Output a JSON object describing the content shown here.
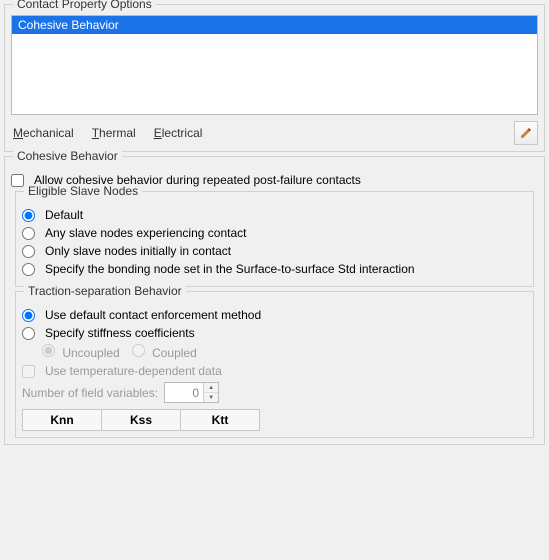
{
  "contact_property_options": {
    "legend": "Contact Property Options",
    "items": [
      "Cohesive Behavior"
    ],
    "selected_index": 0,
    "tabs": {
      "mechanical": "Mechanical",
      "thermal": "Thermal",
      "electrical": "Electrical"
    },
    "edit_tooltip": "Edit"
  },
  "cohesive": {
    "legend": "Cohesive Behavior",
    "allow_repeat": {
      "checked": false,
      "label": "Allow cohesive behavior during repeated post-failure contacts"
    },
    "eligible_slave_nodes": {
      "legend": "Eligible Slave Nodes",
      "selected": "default",
      "options": {
        "default": "Default",
        "any": "Any slave nodes experiencing contact",
        "only": "Only slave nodes initially in contact",
        "specify": "Specify the bonding node set in the Surface-to-surface Std interaction"
      }
    },
    "traction": {
      "legend": "Traction-separation Behavior",
      "selected": "default",
      "options": {
        "default": "Use default contact enforcement method",
        "specify": "Specify stiffness coefficients"
      },
      "coupling": {
        "selected": "uncoupled",
        "uncoupled": "Uncoupled",
        "coupled": "Coupled"
      },
      "use_temp_dependent": {
        "checked": false,
        "label": "Use temperature-dependent data"
      },
      "num_field_vars": {
        "label": "Number of field variables:",
        "value": 0
      },
      "columns": [
        "Knn",
        "Kss",
        "Ktt"
      ]
    }
  }
}
